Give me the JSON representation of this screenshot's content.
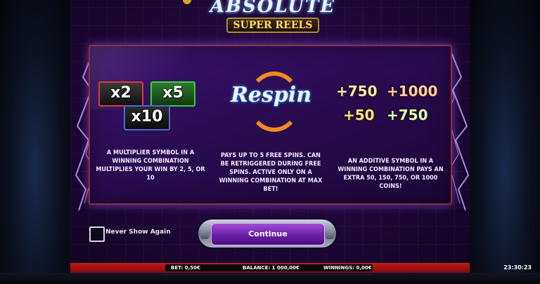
{
  "logo": {
    "title": "ABSOLUTE",
    "subtitle": "SUPER REELS"
  },
  "features": [
    {
      "symbols": [
        "x2",
        "x5",
        "x10"
      ],
      "description": "A MULTIPLIER SYMBOL IN A WINNING COMBINATION MULTIPLIES YOUR WIN BY 2, 5, OR 10"
    },
    {
      "symbol": "Respin",
      "description": "PAYS UP TO 5 FREE SPINS. CAN BE RETRIGGERED DURING FREE SPINS. ACTIVE ONLY ON A WINNING COMBINATION AT MAX BET!"
    },
    {
      "symbols": [
        "+750",
        "+1000",
        "+50",
        "+750"
      ],
      "description": "AN ADDITIVE SYMBOL IN A WINNING COMBINATION PAYS AN EXTRA 50, 150, 750, OR 1000 COINS!"
    }
  ],
  "never_show": {
    "label": "Never Show Again",
    "checked": false
  },
  "continue_button": {
    "label": "Continue"
  },
  "status": {
    "bet": "BET: 0,50€",
    "balance": "BALANCE: 1 000,00€",
    "winnings": "WINNINGS: 0,00€",
    "clock": "23:30:23"
  },
  "colors": {
    "panel_border": "#8f2d3a",
    "continue_button": "#6a1ea6",
    "status_bar": "#c21a1a"
  },
  "icons": [
    "lightning-left-icon",
    "lightning-right-icon",
    "respin-arrows-icon"
  ]
}
